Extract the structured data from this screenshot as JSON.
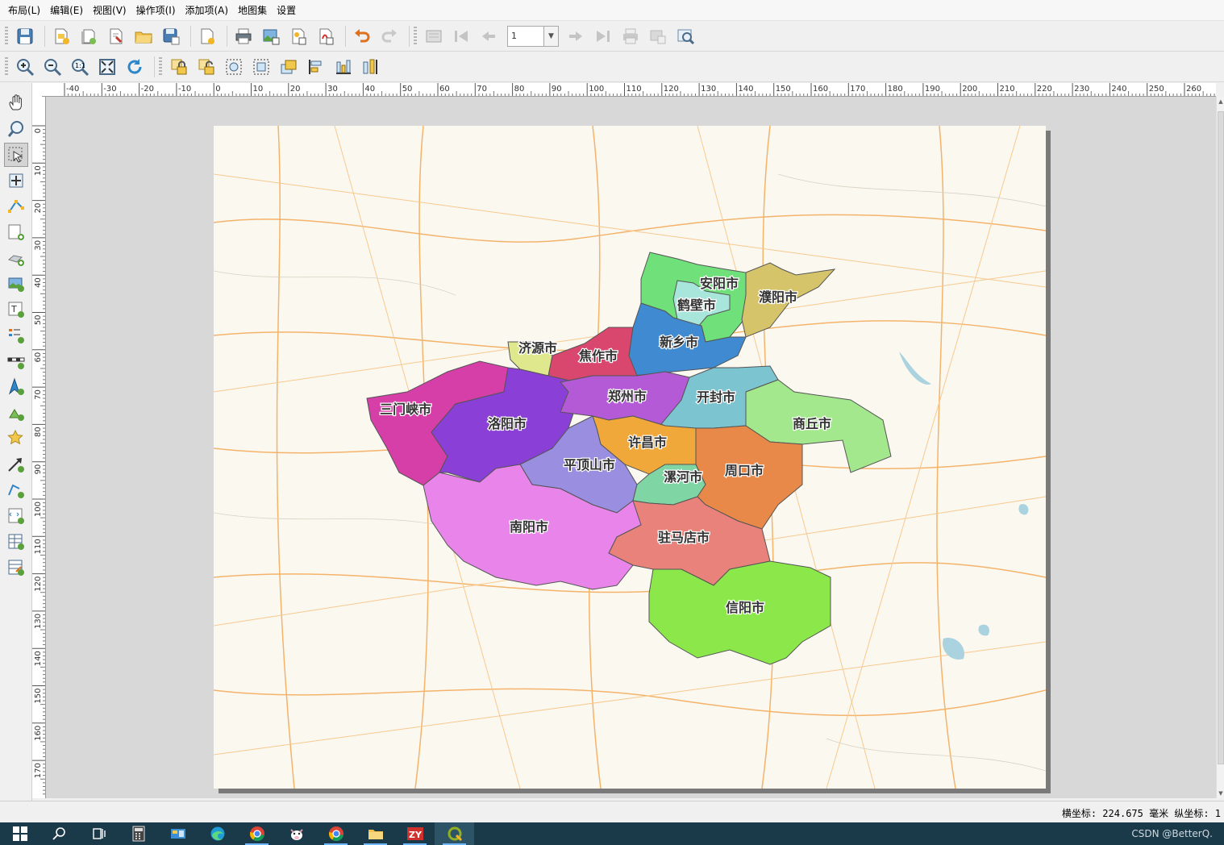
{
  "menubar": {
    "items": [
      "布局(L)",
      "编辑(E)",
      "视图(V)",
      "操作项(I)",
      "添加项(A)",
      "地图集",
      "设置"
    ]
  },
  "toolbar1": {
    "buttons": [
      "save-icon",
      "new-layout-icon",
      "duplicate-layout-icon",
      "layout-manager-icon",
      "open-template-icon",
      "save-template-icon",
      "page-setup-icon",
      "print-icon",
      "export-image-icon",
      "export-svg-icon",
      "export-pdf-icon",
      "undo-icon",
      "redo-icon",
      "atlas-preview-icon",
      "atlas-first-icon",
      "atlas-prev-icon",
      "atlas-next-icon",
      "atlas-last-icon",
      "atlas-print-icon",
      "atlas-export-icon",
      "atlas-settings-icon"
    ],
    "atlas_page_value": "1"
  },
  "toolbar2": {
    "buttons": [
      "zoom-in-icon",
      "zoom-out-icon",
      "zoom-actual-icon",
      "zoom-full-icon",
      "refresh-icon",
      "lock-icon",
      "unlock-icon",
      "group-icon",
      "ungroup-icon",
      "raise-icon",
      "align-icon",
      "distribute-icon",
      "resize-icon"
    ]
  },
  "left_tools": [
    "pan-icon",
    "zoom-tool-icon",
    "select-move-icon",
    "move-content-icon",
    "edit-nodes-icon",
    "add-map-icon",
    "add-3d-map-icon",
    "add-picture-icon",
    "add-label-icon",
    "add-legend-icon",
    "add-scalebar-icon",
    "add-north-arrow-icon",
    "add-shape-icon",
    "add-marker-icon",
    "add-arrow-icon",
    "add-polyline-icon",
    "add-html-icon",
    "add-attribute-table-icon",
    "add-fixed-table-icon"
  ],
  "ruler": {
    "h_labels": [
      "-40",
      "-30",
      "-20",
      "-10",
      "0",
      "10",
      "20",
      "30",
      "40",
      "50",
      "60",
      "70",
      "80",
      "90",
      "100",
      "110",
      "120",
      "130",
      "140",
      "150",
      "160",
      "170",
      "180",
      "190",
      "200",
      "210",
      "220",
      "230",
      "240",
      "250",
      "260"
    ],
    "v_labels": [
      "0",
      "10",
      "20",
      "30",
      "40",
      "50",
      "60",
      "70",
      "80",
      "90",
      "100",
      "110",
      "120",
      "130",
      "140",
      "150",
      "160",
      "170"
    ]
  },
  "map": {
    "cities": [
      {
        "name": "安阳市",
        "color": "#6fe07a"
      },
      {
        "name": "鹤壁市",
        "color": "#a8e6dc"
      },
      {
        "name": "濮阳市",
        "color": "#d6c46a"
      },
      {
        "name": "新乡市",
        "color": "#3f8ad0"
      },
      {
        "name": "焦作市",
        "color": "#d9476f"
      },
      {
        "name": "济源市",
        "color": "#dfe88c"
      },
      {
        "name": "三门峡市",
        "color": "#d63ea8"
      },
      {
        "name": "洛阳市",
        "color": "#8a3fd6"
      },
      {
        "name": "郑州市",
        "color": "#b45ad6"
      },
      {
        "name": "开封市",
        "color": "#7cc4d0"
      },
      {
        "name": "商丘市",
        "color": "#a3e88c"
      },
      {
        "name": "许昌市",
        "color": "#f0a83a"
      },
      {
        "name": "平顶山市",
        "color": "#9a8ee0"
      },
      {
        "name": "漯河市",
        "color": "#7fd6a4"
      },
      {
        "name": "周口市",
        "color": "#e8894a"
      },
      {
        "name": "南阳市",
        "color": "#e985ea"
      },
      {
        "name": "驻马店市",
        "color": "#e8827a"
      },
      {
        "name": "信阳市",
        "color": "#8ce84a"
      }
    ]
  },
  "status": {
    "coord_text": "横坐标: 224.675 毫米 纵坐标: 1"
  },
  "taskbar": {
    "items": [
      "windows-start-icon",
      "search-icon",
      "task-view-icon",
      "calculator-icon",
      "control-panel-icon",
      "edge-icon",
      "chrome-icon",
      "cow-app-icon",
      "chrome-icon-2",
      "file-explorer-icon",
      "zy-app-icon",
      "qgis-icon"
    ],
    "watermark": "CSDN @BetterQ."
  }
}
